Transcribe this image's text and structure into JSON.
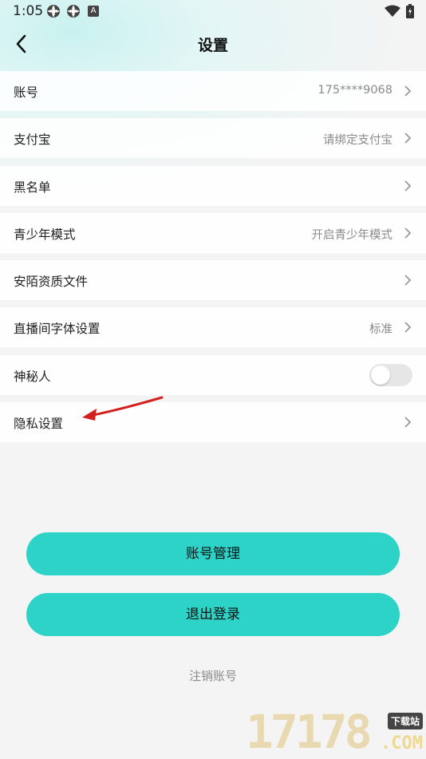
{
  "status_bar": {
    "time": "1:05",
    "badge": "A"
  },
  "nav": {
    "title": "设置"
  },
  "rows": [
    {
      "label": "账号",
      "value": "175****9068"
    },
    {
      "label": "支付宝",
      "value": "请绑定支付宝"
    },
    {
      "label": "黑名单",
      "value": ""
    },
    {
      "label": "青少年模式",
      "value": "开启青少年模式"
    },
    {
      "label": "安陌资质文件",
      "value": ""
    },
    {
      "label": "直播间字体设置",
      "value": "标准"
    },
    {
      "label": "神秘人",
      "toggle": false
    },
    {
      "label": "隐私设置",
      "value": ""
    }
  ],
  "buttons": {
    "account_manage": "账号管理",
    "logout": "退出登录"
  },
  "cancel_account": "注销账号",
  "watermark": {
    "number": "17178",
    "tag": "下载站",
    "domain": ".COM"
  },
  "colors": {
    "accent": "#2ed3c8",
    "annotation_arrow": "#d42020"
  }
}
